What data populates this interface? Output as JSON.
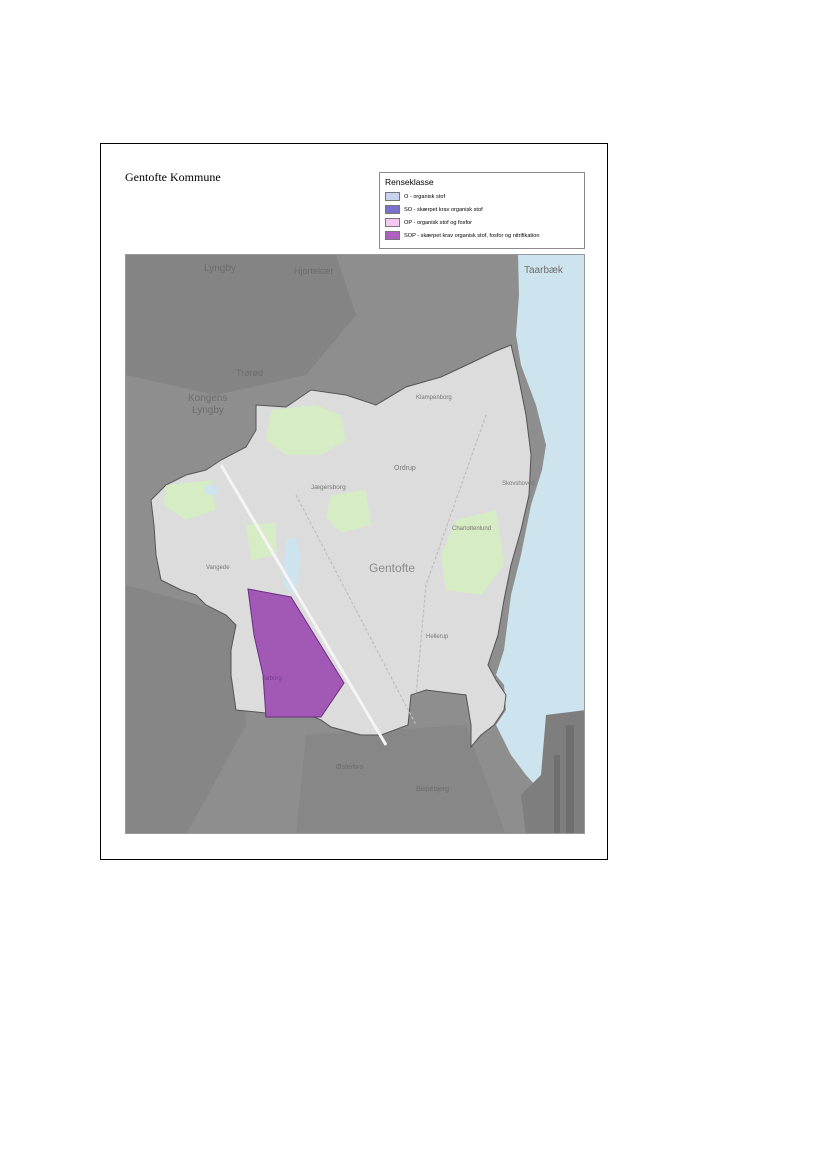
{
  "map_title": "Gentofte Kommune",
  "legend": {
    "title": "Renseklasse",
    "items": [
      {
        "label": "O - organisk stof",
        "color": "#c8d2f0"
      },
      {
        "label": "SO - skærpet krav organisk stof",
        "color": "#7a72c8"
      },
      {
        "label": "OP - organisk stof og fosfor",
        "color": "#f5c8f0"
      },
      {
        "label": "SOP - skærpet krav organisk stof, fosfor og nitrifikation",
        "color": "#b060c0"
      }
    ]
  },
  "places": {
    "lyngby": "Lyngby",
    "hjortekaer": "Hjortekær",
    "taarbaek": "Taarbæk",
    "trorod": "Trørød",
    "kongens_lyngby_1": "Kongens",
    "kongens_lyngby_2": "Lyngby",
    "klampenborg": "Klampenborg",
    "ordrup": "Ordrup",
    "jaegersborg": "Jægersborg",
    "skovshoved": "Skovshoved",
    "charlottenlund": "Charlottenlund",
    "gentofte": "Gentofte",
    "vangede": "Vangede",
    "hellerup": "Hellerup",
    "soborg": "Søborg",
    "bagsvaerd": "",
    "copenhagen_north": "Østerbro",
    "bispebjerg": "Bispebjerg"
  },
  "colors": {
    "outside": "#8e8e8e",
    "municipality": "#dcdcdc",
    "green": "#d6ecc4",
    "water": "#cde3ee",
    "sop_area": "#a259b6"
  }
}
